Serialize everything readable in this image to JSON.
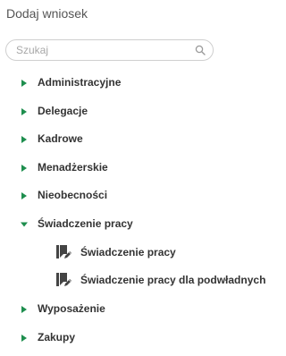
{
  "panel": {
    "title": "Dodaj wniosek"
  },
  "search": {
    "placeholder": "Szukaj",
    "value": ""
  },
  "colors": {
    "accent": "#1e8e4e",
    "icon": "#444444"
  },
  "tree": {
    "categories": [
      {
        "label": "Administracyjne",
        "expanded": false
      },
      {
        "label": "Delegacje",
        "expanded": false
      },
      {
        "label": "Kadrowe",
        "expanded": false
      },
      {
        "label": "Menadżerskie",
        "expanded": false
      },
      {
        "label": "Nieobecności",
        "expanded": false
      },
      {
        "label": "Świadczenie pracy",
        "expanded": true,
        "children": [
          {
            "label": "Świadczenie pracy",
            "icon": "document-edit-icon"
          },
          {
            "label": "Świadczenie pracy dla podwładnych",
            "icon": "document-edit-icon"
          }
        ]
      },
      {
        "label": "Wyposażenie",
        "expanded": false
      },
      {
        "label": "Zakupy",
        "expanded": false
      }
    ]
  }
}
